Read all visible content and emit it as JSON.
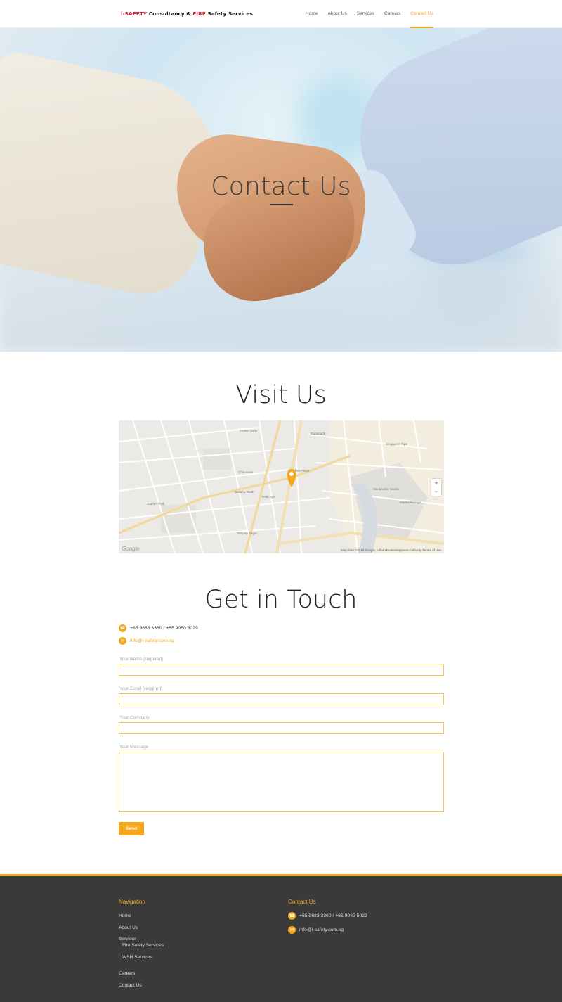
{
  "header": {
    "logo": {
      "part1": "i-SAFETY",
      "part2": " Consultancy & ",
      "part3": "FIRE",
      "part4": " Safety Services"
    },
    "nav": [
      "Home",
      "About Us",
      "Services",
      "Careers",
      "Contact Us"
    ],
    "active_nav": "Contact Us"
  },
  "hero": {
    "title": "Contact Us"
  },
  "visit": {
    "title": "Visit Us",
    "map": {
      "attribution": "Map data ©2016 Google, Urban Redevelopment Authority   Terms of Use",
      "google_logo": "Google",
      "zoom_in": "+",
      "zoom_out": "−",
      "labels": [
        "Clarke Quay",
        "Raffles Place",
        "Chinatown",
        "Marina Bay Sands",
        "Tanjong Pagar",
        "Buddha Tooth",
        "Telok Ayer",
        "Esplanade",
        "Singapore Flyer",
        "Marina Barrage",
        "Outram Park"
      ]
    }
  },
  "touch": {
    "title": "Get in Touch",
    "phone": "+65 9683 3360 / +65 9060 5029",
    "email": "info@i-safety.com.sg"
  },
  "form": {
    "name_label": "Your Name (required)",
    "email_label": "Your Email (required)",
    "company_label": "Your Company",
    "message_label": "Your Message",
    "send_label": "Send"
  },
  "footer": {
    "nav_title": "Navigation",
    "links": {
      "home": "Home",
      "about": "About Us",
      "services": "Services",
      "fire": "Fire Safety Services",
      "wsh": "WSH Services",
      "careers": "Careers",
      "contact": "Contact Us"
    },
    "contact_title": "Contact Us",
    "phone": "+65 9683 3360 / +65 9060 5029",
    "email": "info@i-safety.com.sg"
  },
  "colors": {
    "accent": "#f4a81d",
    "logo_red": "#d3212b",
    "footer_bg": "#3a3a3a"
  },
  "icons": {
    "phone": "phone-icon",
    "email": "email-icon",
    "map_pin": "map-pin-icon"
  }
}
